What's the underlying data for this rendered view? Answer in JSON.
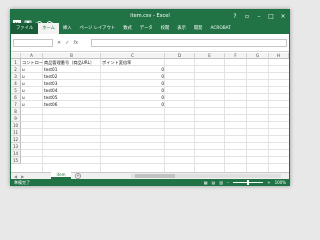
{
  "window": {
    "title": "item.csv - Excel"
  },
  "ribbon": {
    "tabs": [
      "ファイル",
      "ホーム",
      "挿入",
      "ページ レイアウト",
      "数式",
      "データ",
      "校閲",
      "表示",
      "開発",
      "ACROBAT"
    ]
  },
  "formula_bar": {
    "name_box": "",
    "fx_label": "fx",
    "value": ""
  },
  "columns": [
    "A",
    "B",
    "C",
    "D",
    "E",
    "F",
    "G",
    "H"
  ],
  "rows": [
    "1",
    "2",
    "3",
    "4",
    "5",
    "6",
    "7",
    "8",
    "9",
    "10",
    "11",
    "12",
    "13",
    "14",
    "15"
  ],
  "sheet": {
    "header": [
      "コントロー",
      "商品管理番号（商品URL）",
      "ポイント変倍率"
    ],
    "data": [
      [
        "u",
        "test01",
        "0"
      ],
      [
        "u",
        "test02",
        "0"
      ],
      [
        "u",
        "test03",
        "0"
      ],
      [
        "u",
        "test04",
        "0"
      ],
      [
        "u",
        "test05",
        "0"
      ],
      [
        "u",
        "test06",
        "0"
      ]
    ]
  },
  "sheet_tabs": [
    "item"
  ],
  "status": {
    "ready": "準備完了",
    "zoom": "100%"
  },
  "colors": {
    "accent": "#217346"
  }
}
